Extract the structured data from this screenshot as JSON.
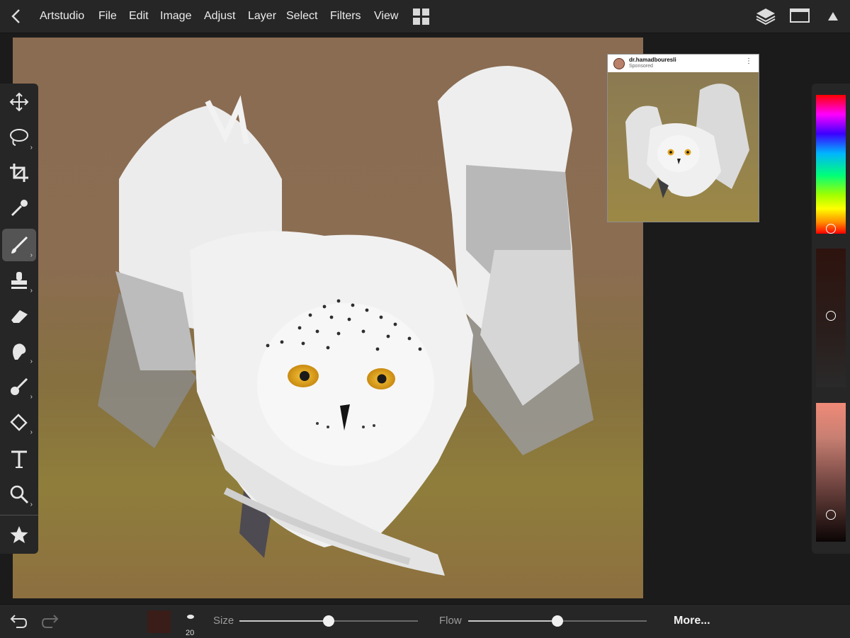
{
  "topbar": {
    "app_menu": "Artstudio",
    "menus": [
      "File",
      "Edit",
      "Image",
      "Adjust",
      "Layer",
      "Select",
      "Filters",
      "View"
    ]
  },
  "toolbar": {
    "tools": [
      "move",
      "lasso",
      "crop",
      "eyedropper",
      "brush",
      "stamp",
      "eraser",
      "smudge",
      "blur",
      "fill",
      "text",
      "zoom",
      "favorites"
    ],
    "active_tool": "brush"
  },
  "reference": {
    "username": "dr.hamadbouresli",
    "subtitle": "Sponsored"
  },
  "colors": {
    "current": "#3a1d18",
    "accent_hue": "#ff0000",
    "panel_bg": "#262626"
  },
  "bottombar": {
    "brush_size_value": "20",
    "size_label": "Size",
    "size_level": 0.5,
    "flow_label": "Flow",
    "flow_level": 0.5,
    "more_label": "More..."
  }
}
